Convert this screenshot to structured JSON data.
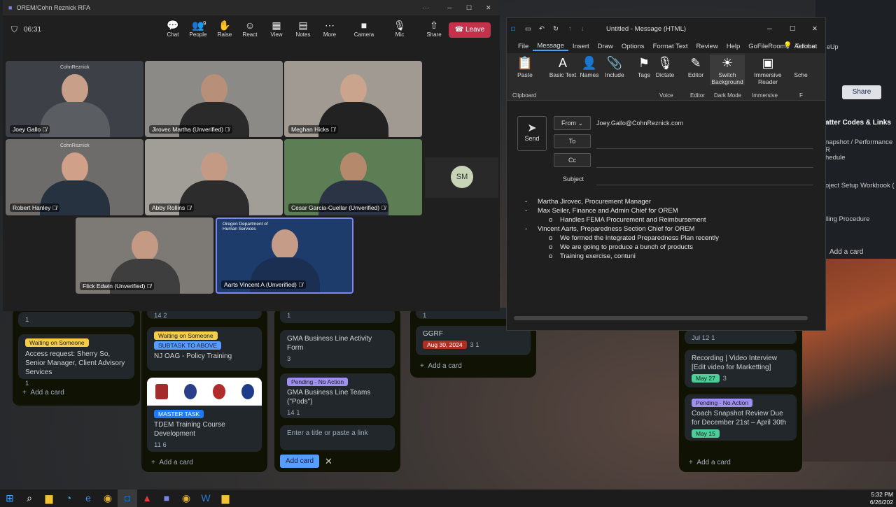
{
  "teams": {
    "title": "OREM/Cohn Reznick RFA",
    "timer": "06:31",
    "controls": [
      {
        "label": "Chat",
        "icon": "chat-icon",
        "glyph": "💬"
      },
      {
        "label": "People",
        "icon": "people-icon",
        "glyph": "👥",
        "badge": "9"
      },
      {
        "label": "Raise",
        "icon": "raise-hand-icon",
        "glyph": "✋"
      },
      {
        "label": "React",
        "icon": "react-icon",
        "glyph": "☺"
      },
      {
        "label": "View",
        "icon": "view-icon",
        "glyph": "▦"
      },
      {
        "label": "Notes",
        "icon": "notes-icon",
        "glyph": "▤"
      },
      {
        "label": "More",
        "icon": "more-icon",
        "glyph": "⋯"
      },
      {
        "label": "Camera",
        "icon": "camera-icon",
        "glyph": "■"
      },
      {
        "label": "Mic",
        "icon": "mic-icon",
        "glyph": "🎙"
      },
      {
        "label": "Share",
        "icon": "share-icon",
        "glyph": "⇧"
      }
    ],
    "leave_label": "Leave",
    "participants": [
      {
        "name": "Joey Gallo",
        "bg": "#3d4147",
        "skin": "#c8a08a",
        "shirt": "#5a5e63"
      },
      {
        "name": "Jirovec Martha (Unverified)",
        "bg": "#8c8a86",
        "skin": "#b88f78",
        "shirt": "#2a2a2a"
      },
      {
        "name": "Meghan Hicks",
        "bg": "#a09a92",
        "skin": "#caa48d",
        "shirt": "#222"
      },
      {
        "name": "Robert Hanley",
        "bg": "#6d6c6a",
        "skin": "#d1a088",
        "shirt": "#263240"
      },
      {
        "name": "Abby Rollins",
        "bg": "#a19d97",
        "skin": "#c49a85",
        "shirt": "#2c2c2c"
      },
      {
        "name": "Cesar Garcia-Cuellar (Unverified)",
        "bg": "#5d7d55",
        "skin": "#b58a6c",
        "shirt": "#2a3444"
      },
      {
        "name": "Flick Edwin (Unverified)",
        "bg": "#7d7a75",
        "skin": "#c49a85",
        "shirt": "#3e3e3e"
      },
      {
        "name": "Aarts Vincent A (Unverified)",
        "bg": "#1d3c6b",
        "skin": "#c59c87",
        "shirt": "#1b2f52"
      }
    ],
    "logo_text": "CohnReznick",
    "dhs_logo_text": "Oregon Department of Human Services",
    "avatar_initials": "SM"
  },
  "outlook": {
    "title": "Untitled  -  Message (HTML)",
    "menu": [
      "File",
      "Message",
      "Insert",
      "Draw",
      "Options",
      "Format Text",
      "Review",
      "Help",
      "GoFileRoom",
      "Acrobat"
    ],
    "tell_me": "Tell me",
    "ribbon": [
      {
        "label": "Paste",
        "icon": "paste-icon",
        "glyph": "📋"
      },
      {
        "label": "Basic Text",
        "icon": "basic-text-icon",
        "glyph": "A"
      },
      {
        "label": "Names",
        "icon": "names-icon",
        "glyph": "👤"
      },
      {
        "label": "Include",
        "icon": "include-icon",
        "glyph": "📎"
      },
      {
        "label": "Tags",
        "icon": "tags-icon",
        "glyph": "⚑"
      },
      {
        "label": "Dictate",
        "icon": "dictate-icon",
        "glyph": "🎙"
      },
      {
        "label": "Editor",
        "icon": "editor-icon",
        "glyph": "✎"
      },
      {
        "label": "Switch Background",
        "icon": "switch-background-icon",
        "glyph": "☀"
      },
      {
        "label": "Immersive Reader",
        "icon": "immersive-reader-icon",
        "glyph": "▣"
      },
      {
        "label": "Sche",
        "icon": "schedule-icon",
        "glyph": ""
      }
    ],
    "groups": [
      "Clipboard",
      "Voice",
      "Editor",
      "Dark Mode",
      "Immersive",
      "F"
    ],
    "send_label": "Send",
    "from_label": "From",
    "from_value": "Joey.Gallo@CohnReznick.com",
    "to_label": "To",
    "cc_label": "Cc",
    "subject_label": "Subject",
    "body_lines": [
      {
        "level": 1,
        "bullet": "-",
        "text": "Martha Jirovec, Procurement Manager"
      },
      {
        "level": 1,
        "bullet": "-",
        "text": "Max Seiler, Finance and Admin Chief for OREM"
      },
      {
        "level": 2,
        "bullet": "o",
        "text": "Handles FEMA Procurement and Reimbursement"
      },
      {
        "level": 1,
        "bullet": "-",
        "text": "Vincent Aarts, Preparedness Section Chief for OREM"
      },
      {
        "level": 2,
        "bullet": "o",
        "text": "We formed the Integrated Preparedness Plan recently"
      },
      {
        "level": 2,
        "bullet": "o",
        "text": "We are going to produce a bunch of products"
      },
      {
        "level": 2,
        "bullet": "o",
        "text": "Training exercise, contuni"
      }
    ]
  },
  "trello": {
    "list1": {
      "cards": [
        {
          "meta": "1"
        },
        {
          "tag": "Waiting on Someone",
          "title": "Access request: Sherry So, Senior Manager, Client Advisory Services",
          "meta": "1"
        }
      ]
    },
    "list2": {
      "cards": [
        {
          "meta": "14  2"
        },
        {
          "tags": [
            "Waiting on Someone",
            "SUBTASK TO ABOVE"
          ],
          "title": "NJ OAG - Policy Training"
        },
        {
          "tag": "MASTER TASK",
          "title": "TDEM Training Course Development",
          "meta": "11   6"
        }
      ]
    },
    "list3": {
      "cards": [
        {
          "meta": "1"
        },
        {
          "title": "GMA Business Line Activity Form",
          "meta": "3"
        },
        {
          "tag": "Pending - No Action",
          "title": "GMA Business Line Teams (\"Pods\")",
          "meta": "14   1"
        }
      ],
      "input_placeholder": "Enter a title or paste a link",
      "add_button": "Add card"
    },
    "list4": {
      "cards": [
        {
          "meta": "1"
        },
        {
          "title": "GGRF",
          "date": "Aug 30, 2024",
          "meta": "3   1"
        }
      ]
    },
    "list5": {
      "cards": [
        {
          "date": "Jul 12",
          "meta": "1"
        },
        {
          "title": "Recording | Video Interview [Edit video for Marketting]",
          "date": "May 27",
          "meta": "3"
        },
        {
          "tag": "Pending - No Action",
          "title": "Coach Snapshot Review Due for December 21st – April 30th",
          "date": "May 15"
        }
      ]
    },
    "add_card": "Add a card",
    "right_panel": {
      "share": "Share",
      "heading": "atter Codes & Links",
      "items": [
        "napshot / Performance R\nhedule",
        "oject Setup Workbook (",
        "lling Procedure"
      ],
      "add_card": "Add a card",
      "tab": "eUp"
    }
  },
  "clock": {
    "time": "5:32 PM",
    "date": "6/26/202"
  }
}
